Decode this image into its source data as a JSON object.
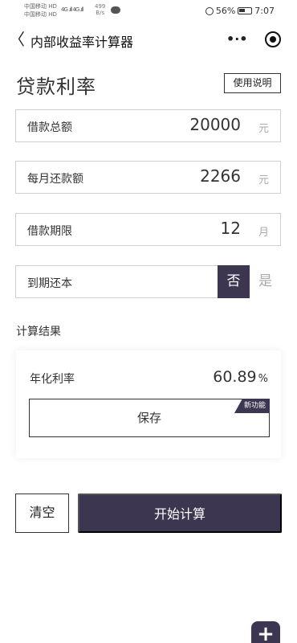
{
  "status_bar": {
    "carrier_1": "中国移动 HD",
    "carrier_2": "中国移动 HD",
    "signal": "4G .ıll 4G .ıll",
    "speed_value": "499",
    "speed_unit": "B/s",
    "battery_percent": "56%",
    "time": "7:07"
  },
  "nav": {
    "title": "内部收益率计算器",
    "more_glyph": "•·•",
    "back_glyph": "〈"
  },
  "page": {
    "title": "贷款利率",
    "help_label": "使用说明"
  },
  "fields": {
    "loan_amount": {
      "label": "借款总额",
      "value": "20000",
      "unit": "元"
    },
    "monthly_payment": {
      "label": "每月还款额",
      "value": "2266",
      "unit": "元"
    },
    "term": {
      "label": "借款期限",
      "value": "12",
      "unit": "月"
    },
    "balloon": {
      "label": "到期还本",
      "option_no": "否",
      "option_yes": "是",
      "selected": "否"
    }
  },
  "result": {
    "section_label": "计算结果",
    "label": "年化利率",
    "value": "60.89",
    "unit": "%",
    "save_label": "保存",
    "new_badge": "新功能"
  },
  "actions": {
    "clear_label": "清空",
    "start_label": "开始计算"
  },
  "fab": {
    "glyph": "+"
  },
  "colors": {
    "accent": "#3d3650",
    "border": "#cfcfcf",
    "muted_text": "#aaaaaa"
  }
}
